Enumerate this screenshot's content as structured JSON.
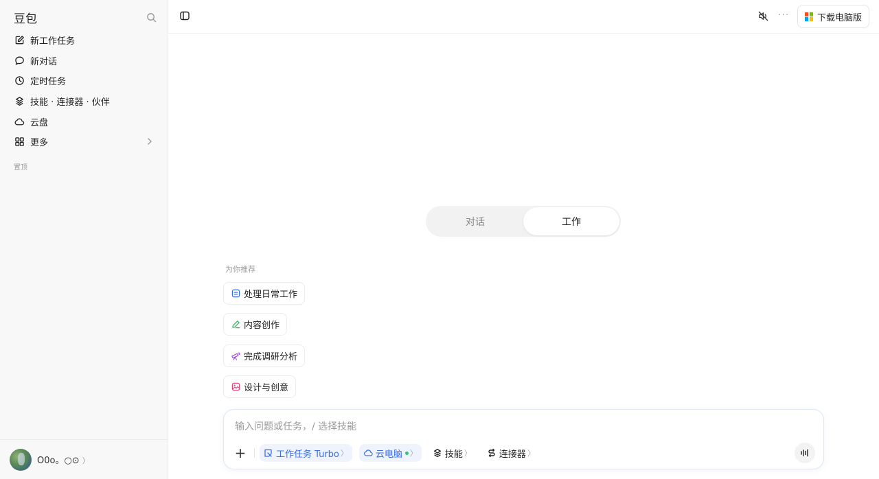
{
  "sidebar": {
    "brand": "豆包",
    "items": [
      {
        "label": "新工作任务",
        "icon": "edit-icon"
      },
      {
        "label": "新对话",
        "icon": "chat-bubble-icon"
      },
      {
        "label": "定时任务",
        "icon": "clock-icon"
      },
      {
        "label": "技能 · 连接器 · 伙伴",
        "icon": "layers-icon"
      },
      {
        "label": "云盘",
        "icon": "cloud-icon"
      },
      {
        "label": "更多",
        "icon": "grid-icon"
      }
    ],
    "section_label": "置顶",
    "user": {
      "name": "O0o。○⊙",
      "chevron": "〉"
    }
  },
  "topbar": {
    "download_label": "下载电脑版",
    "more": "···"
  },
  "mode_toggle": {
    "tabs": [
      "对话",
      "工作"
    ],
    "active": "工作"
  },
  "recommend": {
    "label": "为你推荐",
    "chips": [
      {
        "label": "处理日常工作",
        "icon": "doc-icon",
        "color": "#3b6fe0"
      },
      {
        "label": "内容创作",
        "icon": "pen-icon",
        "color": "#2fb35a"
      },
      {
        "label": "完成调研分析",
        "icon": "telescope-icon",
        "color": "#a64ad6"
      },
      {
        "label": "设计与创意",
        "icon": "image-icon",
        "color": "#e0457b"
      }
    ]
  },
  "composer": {
    "placeholder": "输入问题或任务，/ 选择技能",
    "plus": "+",
    "tools": {
      "work_task": "工作任务 Turbo",
      "cloud_pc": "云电脑",
      "skills": "技能",
      "connectors": "连接器",
      "arrow": "〉"
    }
  },
  "colors": {
    "accent": "#3b6fe0",
    "online": "#38c172"
  }
}
